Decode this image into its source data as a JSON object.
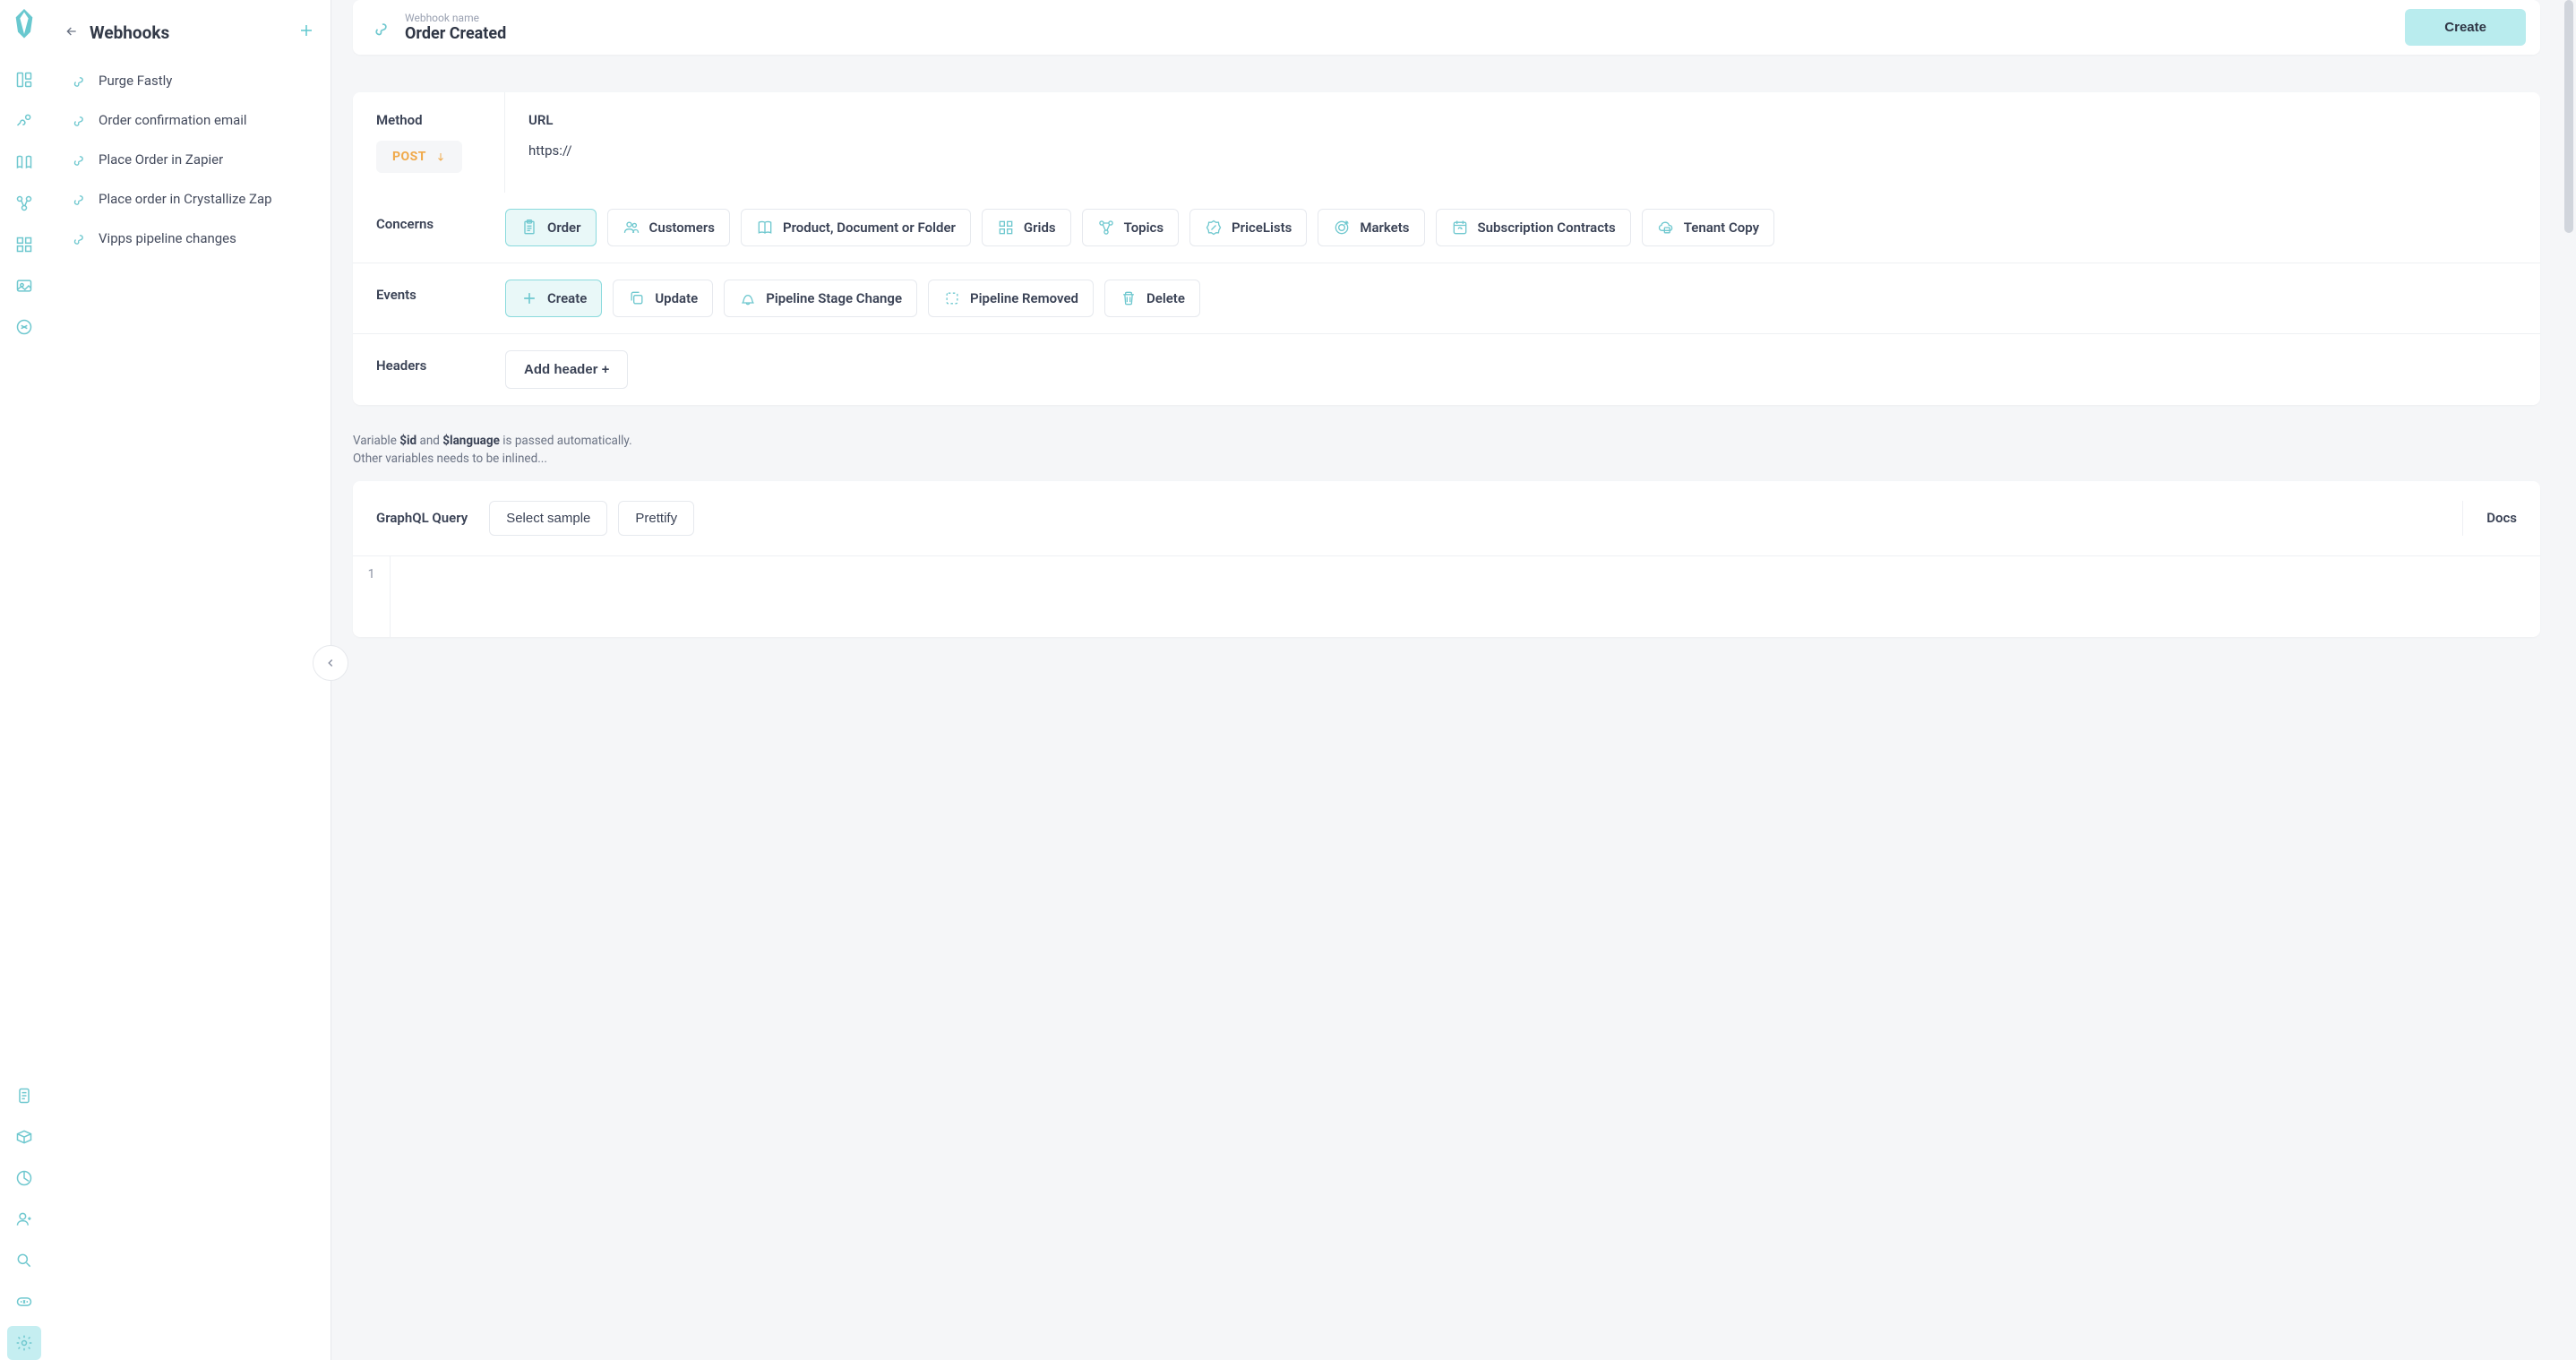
{
  "sidebar": {
    "title": "Webhooks",
    "items": [
      {
        "label": "Purge Fastly"
      },
      {
        "label": "Order confirmation email"
      },
      {
        "label": "Place Order in Zapier"
      },
      {
        "label": "Place order in Crystallize Zap"
      },
      {
        "label": "Vipps pipeline changes"
      }
    ]
  },
  "header": {
    "label": "Webhook name",
    "value": "Order Created",
    "create_btn": "Create"
  },
  "method": {
    "label": "Method",
    "value": "POST"
  },
  "url": {
    "label": "URL",
    "value": "https://"
  },
  "concerns": {
    "label": "Concerns",
    "options": [
      {
        "label": "Order",
        "selected": true
      },
      {
        "label": "Customers"
      },
      {
        "label": "Product, Document or Folder"
      },
      {
        "label": "Grids"
      },
      {
        "label": "Topics"
      },
      {
        "label": "PriceLists"
      },
      {
        "label": "Markets"
      },
      {
        "label": "Subscription Contracts"
      },
      {
        "label": "Tenant Copy"
      }
    ]
  },
  "events": {
    "label": "Events",
    "options": [
      {
        "label": "Create",
        "selected": true
      },
      {
        "label": "Update"
      },
      {
        "label": "Pipeline Stage Change"
      },
      {
        "label": "Pipeline Removed"
      },
      {
        "label": "Delete"
      }
    ]
  },
  "headers_section": {
    "label": "Headers",
    "add_btn": "Add header +"
  },
  "hint": {
    "prefix": "Variable ",
    "var1": "$id",
    "mid": " and ",
    "var2": "$language",
    "suffix": " is passed automatically.",
    "line2": "Other variables needs to be inlined..."
  },
  "query": {
    "title": "GraphQL Query",
    "select_sample": "Select sample",
    "prettify": "Prettify",
    "docs": "Docs",
    "line_number": "1"
  }
}
